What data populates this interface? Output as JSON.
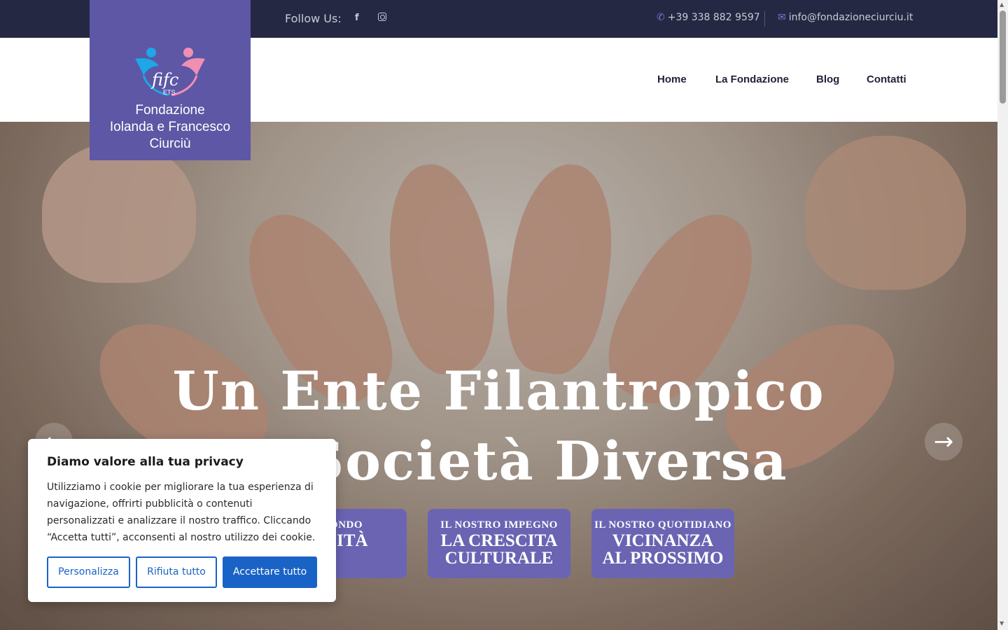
{
  "topbar": {
    "follow_label": "Follow Us:",
    "facebook_glyph": "f",
    "phone": "+39 338 882 9597",
    "email": "info@fondazioneciurciu.it"
  },
  "logo": {
    "name_line1": "Fondazione",
    "name_line2": "Iolanda e Francesco",
    "name_line3": "Ciurciù"
  },
  "nav": {
    "items": [
      "Home",
      "La Fondazione",
      "Blog",
      "Contatti"
    ]
  },
  "hero": {
    "headline_line1": "Un Ente Filantropico",
    "headline_line2": "na Società Diversa",
    "cards": [
      {
        "small": "O MONDO",
        "big": "ERSITÀ"
      },
      {
        "small": "IL NOSTRO IMPEGNO",
        "big1": "LA CRESCITA",
        "big2": "CULTURALE"
      },
      {
        "small": "IL NOSTRO QUOTIDIANO",
        "big1": "VICINANZA",
        "big2": "AL PROSSIMO"
      }
    ],
    "prev_arrow": "←",
    "next_arrow": "→"
  },
  "cookie": {
    "title": "Diamo valore alla tua privacy",
    "text": "Utilizziamo i cookie per migliorare la tua esperienza di navigazione, offrirti pubblicità o contenuti personalizzati e analizzare il nostro traffico. Cliccando “Accetta tutti”, acconsenti al nostro utilizzo dei cookie.",
    "customize": "Personalizza",
    "reject": "Rifiuta tutto",
    "accept": "Accettare tutto"
  },
  "colors": {
    "topbar_bg": "#252842",
    "logo_bg": "#5d57a5",
    "card_bg": "#6a64b3",
    "accent_blue": "#1a63c6"
  }
}
